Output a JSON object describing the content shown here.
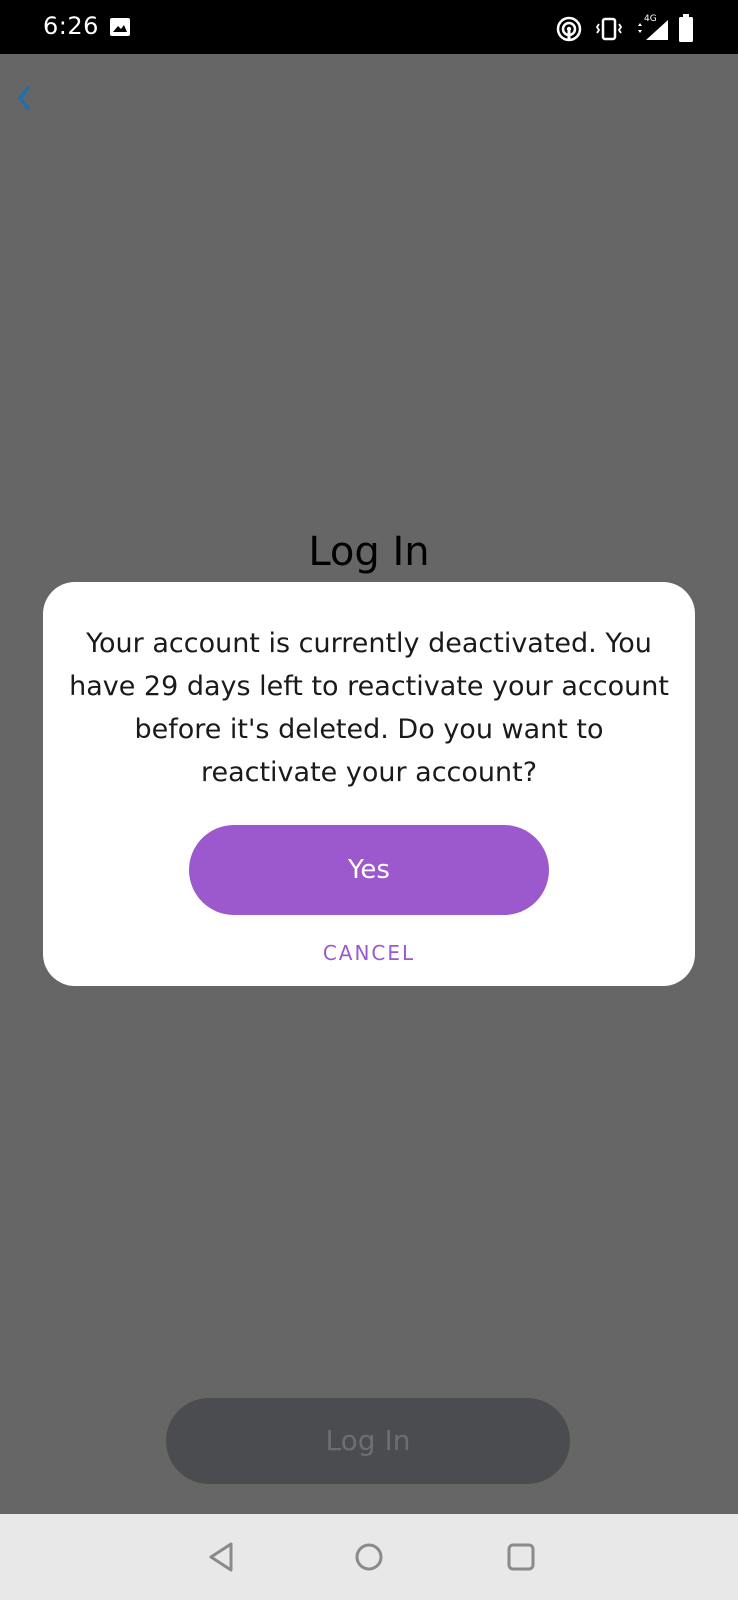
{
  "status_bar": {
    "time": "6:26",
    "network_label": "4G",
    "icons": [
      "image-icon",
      "hotspot-icon",
      "vibrate-icon",
      "signal-icon",
      "battery-icon"
    ]
  },
  "header": {
    "back_icon": "chevron-left-icon"
  },
  "page": {
    "title": "Log In",
    "login_button_label": "Log In"
  },
  "dialog": {
    "message": "Your account is currently deactivated. You have 29 days left to reactivate your account before it's deleted. Do you want to reactivate your account?",
    "yes_label": "Yes",
    "cancel_label": "CANCEL"
  },
  "nav_bar": {
    "icons": [
      "back-triangle-icon",
      "home-circle-icon",
      "recents-square-icon"
    ]
  },
  "colors": {
    "accent": "#9b59cd",
    "overlay_background": "#666666",
    "status_bar": "#000000",
    "back_chevron": "#1f6fa8"
  }
}
